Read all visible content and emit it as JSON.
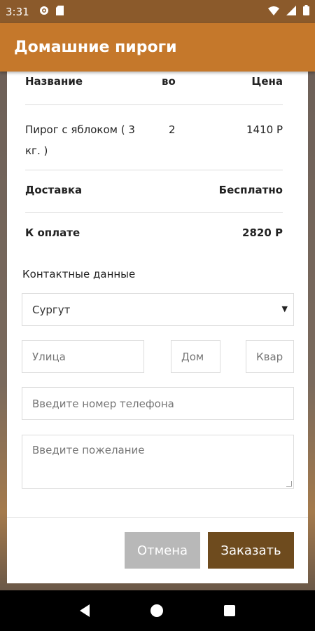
{
  "status_bar": {
    "time": "3:31",
    "icons": [
      "gear-icon",
      "sd-card-icon",
      "wifi-icon",
      "signal-icon",
      "battery-icon"
    ]
  },
  "app_bar": {
    "title": "Домашние пироги"
  },
  "order_table": {
    "headers": [
      "Название",
      "во",
      "Цена"
    ],
    "items": [
      {
        "name": "Пирог с яблоком ( 3 кг. )",
        "qty": "2",
        "price": "1410 Р"
      }
    ],
    "delivery_label": "Доставка",
    "delivery_value": "Бесплатно",
    "total_label": "К оплате",
    "total_value": "2820 Р"
  },
  "contact": {
    "label": "Контактные данные",
    "city": "Сургут",
    "street_placeholder": "Улица",
    "house_placeholder": "Дом",
    "apartment_placeholder": "Квар",
    "phone_placeholder": "Введите номер телефона",
    "wish_placeholder": "Введите пожелание"
  },
  "buttons": {
    "cancel": "Отмена",
    "order": "Заказать"
  },
  "colors": {
    "status_bar": "#8b5a2b",
    "app_bar": "#c5782b",
    "order_button": "#6e4b1e",
    "cancel_button": "#b8b8b8"
  }
}
